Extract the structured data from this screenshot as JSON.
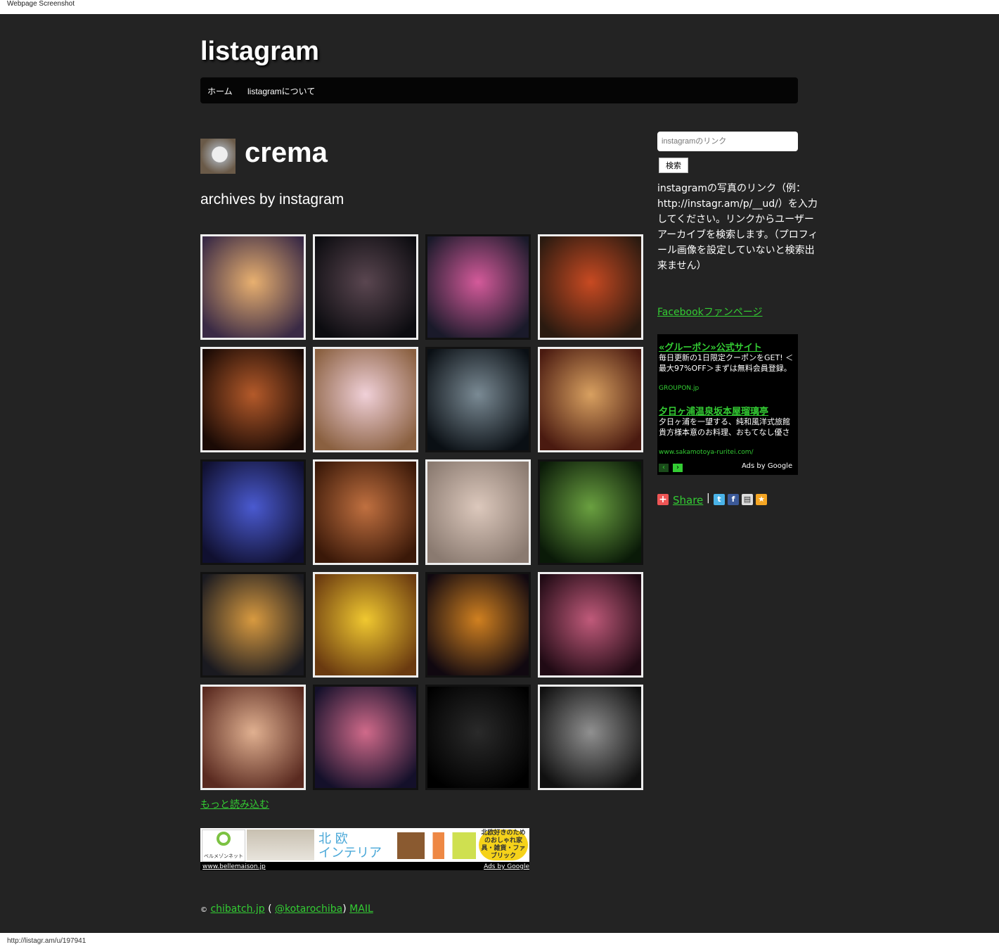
{
  "window": {
    "caption": "Webpage Screenshot",
    "status_url": "http://listagr.am/u/197941"
  },
  "site": {
    "logo": "listagram"
  },
  "nav": {
    "items": [
      "ホーム",
      "listagramについて"
    ]
  },
  "profile": {
    "username": "crema",
    "subtitle": "archives by instagram"
  },
  "photos": {
    "items": [
      {
        "name": "plant-shadow-photo",
        "c1": "#e8b070",
        "c2": "#3a2a45"
      },
      {
        "name": "night-street-photo",
        "c1": "#5a4650",
        "c2": "#0c0c10"
      },
      {
        "name": "sneakers-photo",
        "c1": "#d45a9a",
        "c2": "#1a1a2a"
      },
      {
        "name": "soup-bowl-photo",
        "c1": "#c84a22",
        "c2": "#2a1a10"
      },
      {
        "name": "coffee-beans-photo",
        "c1": "#b45a2a",
        "c2": "#1a0a05"
      },
      {
        "name": "cherry-chocolate-photo",
        "c1": "#f0d0d8",
        "c2": "#8a6040"
      },
      {
        "name": "frosted-glass-photo",
        "c1": "#7a8a94",
        "c2": "#0a0f14"
      },
      {
        "name": "closed-sign-photo",
        "c1": "#d8a060",
        "c2": "#4a1a10"
      },
      {
        "name": "flag-ribbon-photo",
        "c1": "#4a5ad0",
        "c2": "#101030"
      },
      {
        "name": "toothpicks-photo",
        "c1": "#c07040",
        "c2": "#3a1808"
      },
      {
        "name": "glass-cup-photo",
        "c1": "#dcc8bc",
        "c2": "#8a7a70"
      },
      {
        "name": "ladybug-flowers-photo",
        "c1": "#6aa040",
        "c2": "#0a1a08"
      },
      {
        "name": "corona-bottles-photo",
        "c1": "#d89a40",
        "c2": "#1a1a20"
      },
      {
        "name": "yellow-fabric-photo",
        "c1": "#f0c830",
        "c2": "#6a3a10"
      },
      {
        "name": "bracelet-photo",
        "c1": "#d08020",
        "c2": "#100810"
      },
      {
        "name": "la-crema-cork-photo",
        "c1": "#c05a7a",
        "c2": "#200a14"
      },
      {
        "name": "necklace-photo",
        "c1": "#e0b090",
        "c2": "#5a2a20"
      },
      {
        "name": "nail-ring-photo",
        "c1": "#d06a8a",
        "c2": "#14102a"
      },
      {
        "name": "polka-dots-photo",
        "c1": "#2a2a2a",
        "c2": "#000000"
      },
      {
        "name": "motorcycle-wheel-photo",
        "c1": "#909090",
        "c2": "#101010"
      }
    ]
  },
  "more_link": "もっと読み込む",
  "bottom_ad": {
    "title_top": "北 欧",
    "title_bottom": "インテリア",
    "badge": "北欧好きのためのおしゃれ家具・雑貨・ファブリック",
    "brand": "ベルメゾンネット",
    "url": "www.bellemaison.jp",
    "ads_by": "Ads by Google"
  },
  "footer": {
    "copyright": "©",
    "site_link": "chibatch.jp",
    "open_paren": "(",
    "twitter_link": "@kotarochiba",
    "close_paren": ")",
    "mail_link": "MAIL"
  },
  "sidebar": {
    "search_placeholder": "instagramのリンク",
    "search_button": "検索",
    "help_text": "instagramの写真のリンク（例：http://instagr.am/p/__ud/）を入力してください。リンクからユーザーアーカイブを検索します。（プロフィール画像を設定していないと検索出来ません）",
    "facebook_link": "Facebookファンページ",
    "ad": {
      "ad1_title": "«グルーポン»公式サイト",
      "ad1_body": "毎日更新の1日限定クーポンをGET! ＜最大97%OFF＞まずは無料会員登録。",
      "ad1_url": "GROUPON.jp",
      "ad2_title": "夕日ヶ浦温泉坂本屋瑠璃亭",
      "ad2_body": "夕日ヶ浦を一望する、純和風洋式旅館 貴方様本意のお料理、おもてなし優さ",
      "ad2_url": "www.sakamotoya-ruritei.com/",
      "ads_by": "Ads by Google"
    },
    "share_label": "Share",
    "share_sep": "|"
  },
  "colors": {
    "background": "#232323",
    "link": "#33cc33",
    "nav": "#050505"
  }
}
